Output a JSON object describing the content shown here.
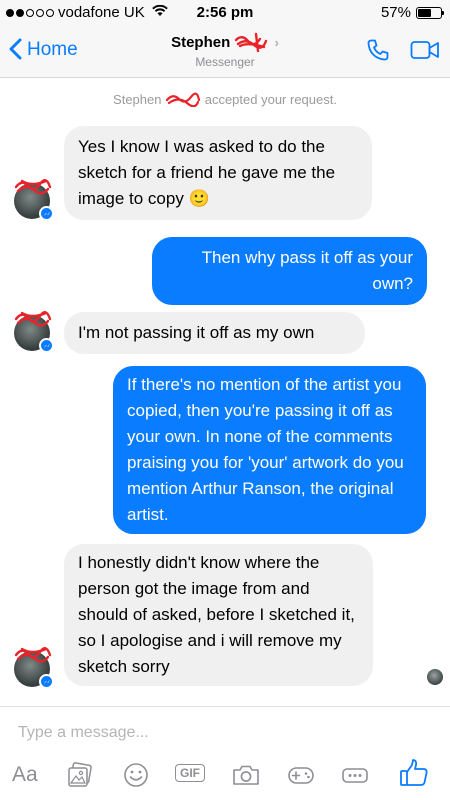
{
  "status_bar": {
    "carrier": "vodafone UK",
    "time": "2:56 pm",
    "battery": "57%",
    "battery_level": 0.57
  },
  "nav": {
    "back_label": "Home",
    "contact_name": "Stephen",
    "subtitle": "Messenger"
  },
  "system_message": {
    "prefix": "Stephen",
    "suffix": "accepted your request."
  },
  "messages": [
    {
      "direction": "in",
      "text": "Yes I know I was asked to do the sketch for a friend he gave me the image to copy 🙂"
    },
    {
      "direction": "out",
      "text": "Then why pass it off as your own?"
    },
    {
      "direction": "in",
      "text": "I'm not passing it off as my own"
    },
    {
      "direction": "out",
      "text": "If there's no mention of the artist you copied, then you're passing it off as your own. In none of the comments praising you for 'your' artwork do you mention Arthur Ranson, the original artist."
    },
    {
      "direction": "in",
      "text": "I honestly didn't know where the person got the image from and should of asked, before I sketched it, so I apologise and i will remove my sketch sorry"
    }
  ],
  "composer": {
    "placeholder": "Type a message...",
    "aa_label": "Aa",
    "gif_label": "GIF"
  },
  "colors": {
    "accent": "#0a7cff",
    "incoming_bubble": "#f1f0f0",
    "redaction": "#e8242a"
  }
}
